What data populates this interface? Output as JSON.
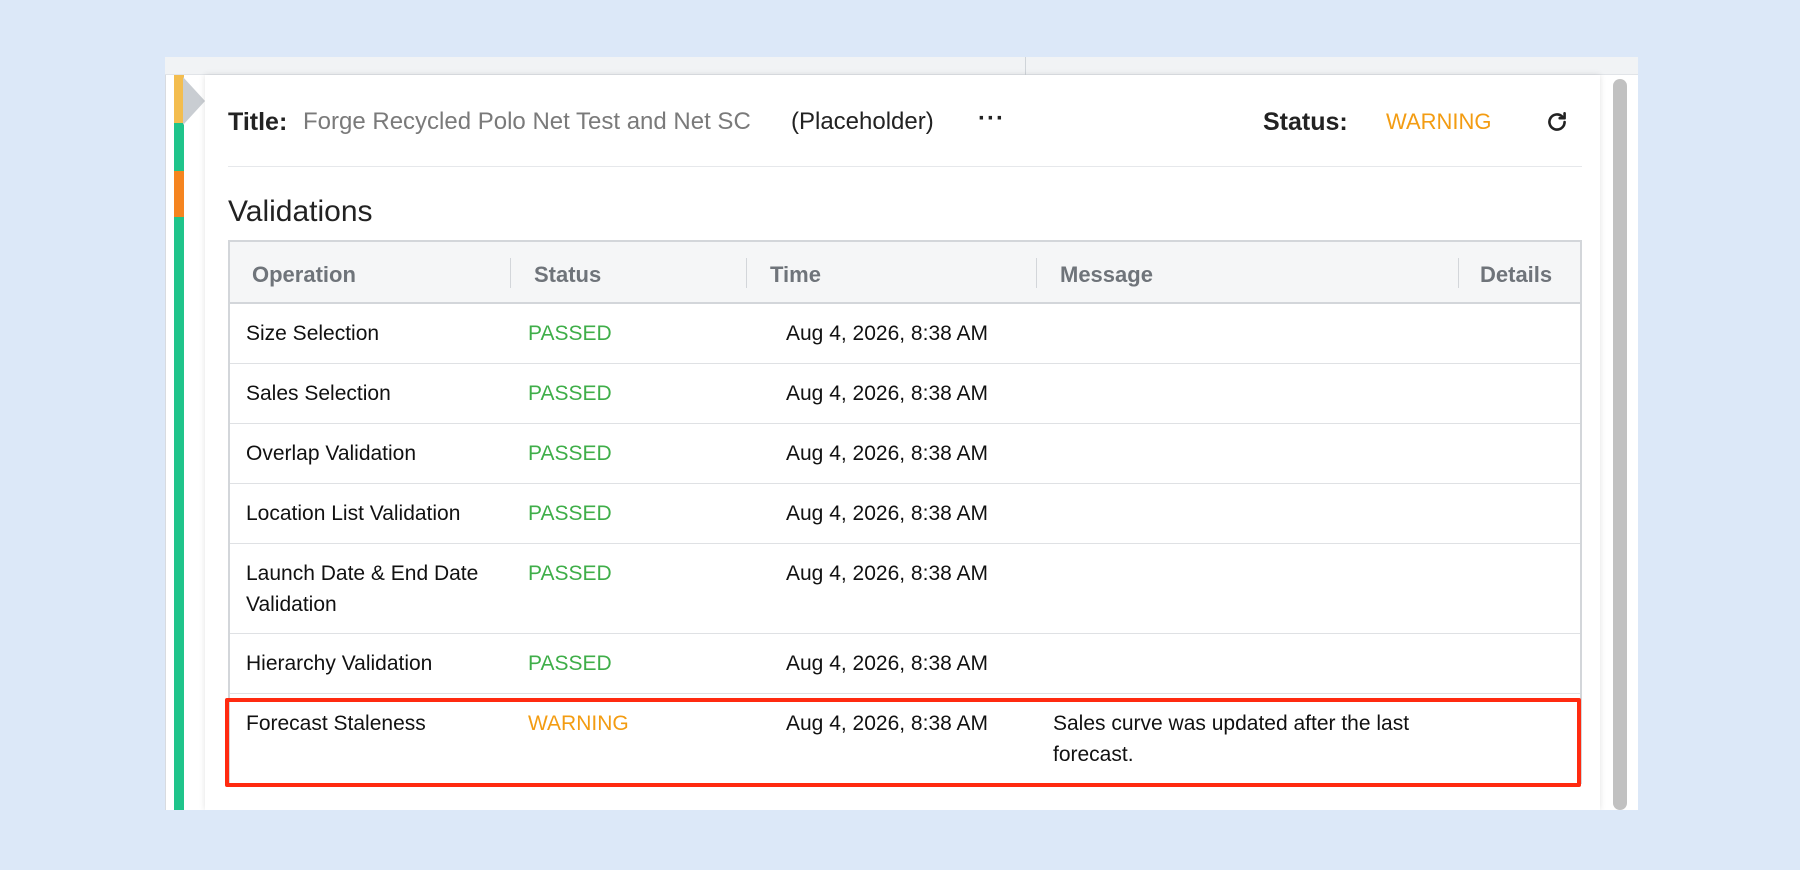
{
  "header": {
    "title_label": "Title:",
    "title_value": "Forge Recycled Polo Net Test and Net SC",
    "title_suffix": "(Placeholder)",
    "more_label": "···",
    "status_label": "Status:",
    "status_value": "WARNING"
  },
  "section": {
    "title": "Validations"
  },
  "table": {
    "columns": [
      "Operation",
      "Status",
      "Time",
      "Message",
      "Details"
    ],
    "rows": [
      {
        "operation": "Size Selection",
        "status": "PASSED",
        "time": "Aug 4, 2026, 8:38 AM",
        "message": "",
        "details": ""
      },
      {
        "operation": "Sales Selection",
        "status": "PASSED",
        "time": "Aug 4, 2026, 8:38 AM",
        "message": "",
        "details": ""
      },
      {
        "operation": "Overlap Validation",
        "status": "PASSED",
        "time": "Aug 4, 2026, 8:38 AM",
        "message": "",
        "details": ""
      },
      {
        "operation": "Location List Validation",
        "status": "PASSED",
        "time": "Aug 4, 2026, 8:38 AM",
        "message": "",
        "details": ""
      },
      {
        "operation": "Launch Date & End Date Validation",
        "status": "PASSED",
        "time": "Aug 4, 2026, 8:38 AM",
        "message": "",
        "details": ""
      },
      {
        "operation": "Hierarchy Validation",
        "status": "PASSED",
        "time": "Aug 4, 2026, 8:38 AM",
        "message": "",
        "details": ""
      },
      {
        "operation": "Forecast Staleness",
        "status": "WARNING",
        "time": "Aug 4, 2026, 8:38 AM",
        "message": "Sales curve was updated after the last forecast.",
        "details": ""
      }
    ]
  },
  "colors": {
    "passed": "#3fae49",
    "warning": "#f39c12",
    "highlight": "#ff2a10",
    "strip_green": "#1fc48a",
    "strip_orange": "#f5841f",
    "strip_yellow": "#f3bd4f"
  },
  "icons": {
    "refresh": "refresh-icon",
    "more": "more-horizontal-icon"
  }
}
